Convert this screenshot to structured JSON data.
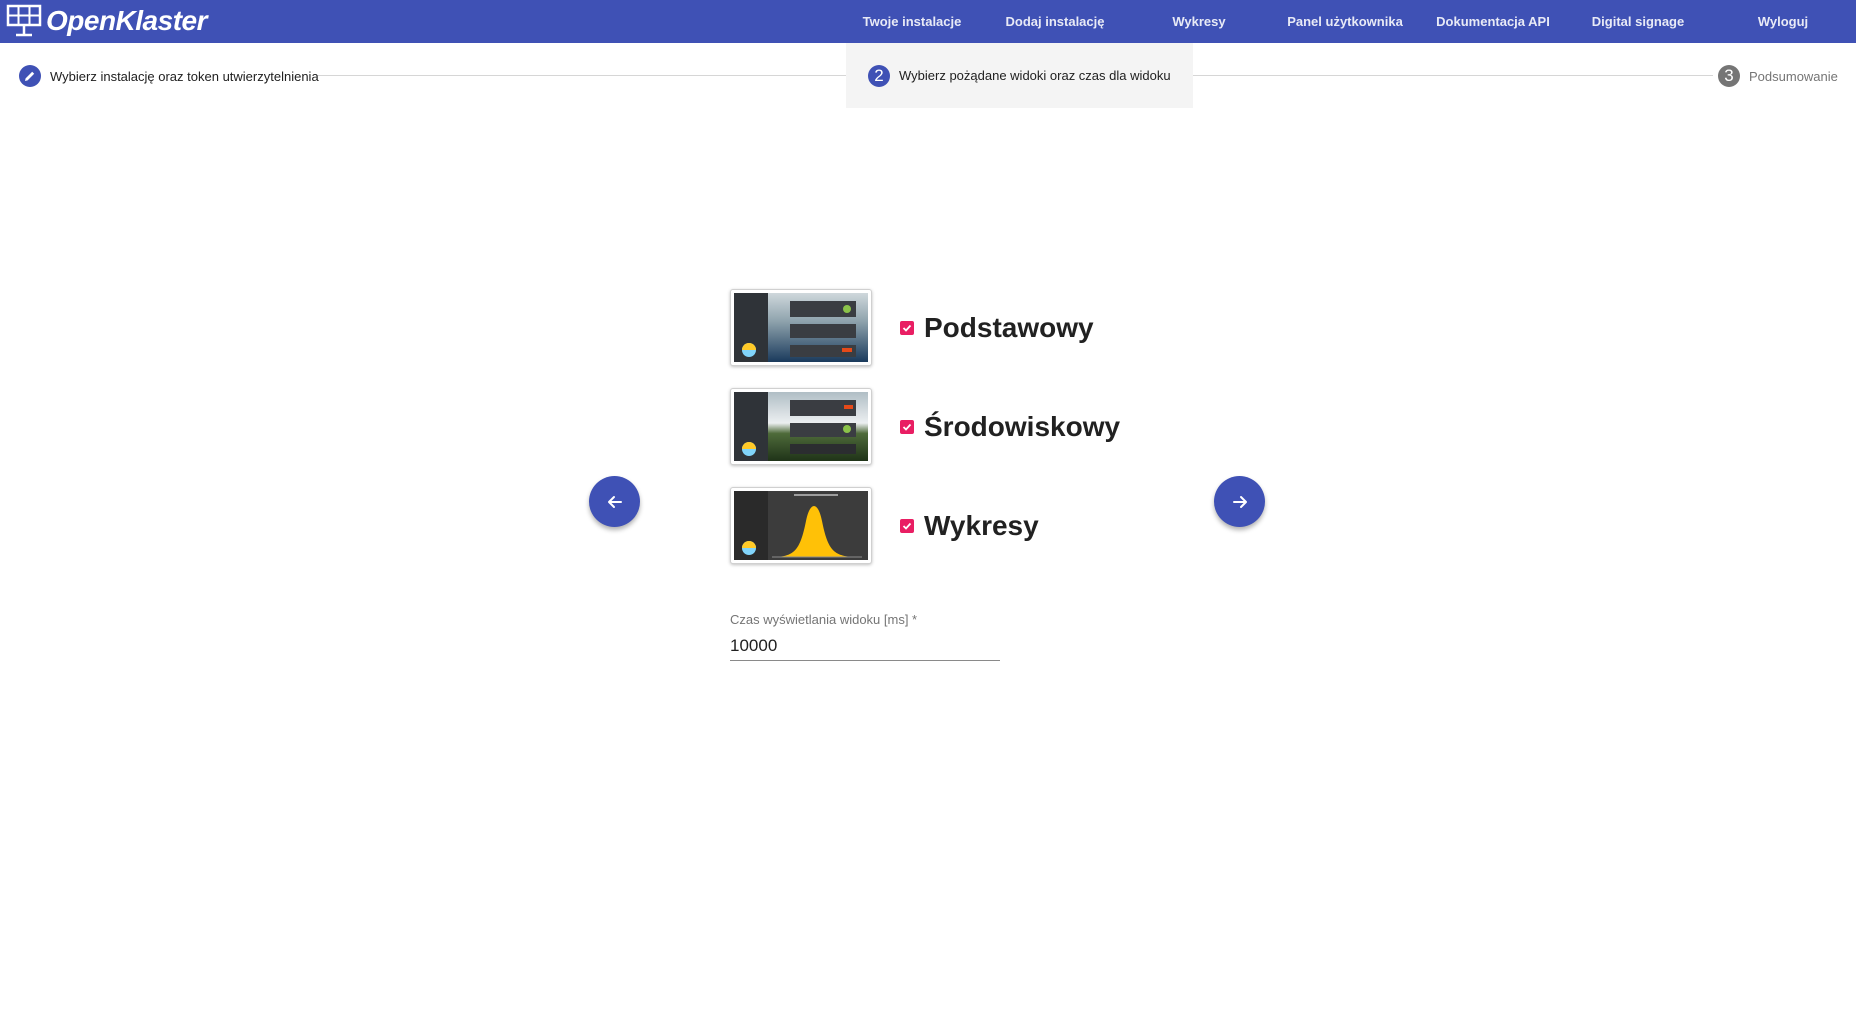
{
  "app": {
    "brand": "OpenKlaster",
    "colors": {
      "primary": "#3f51b5",
      "accent": "#e91e63",
      "chart_fill": "#ffc107"
    }
  },
  "nav": {
    "items": [
      {
        "label": "Twoje instalacje"
      },
      {
        "label": "Dodaj instalację"
      },
      {
        "label": "Wykresy"
      },
      {
        "label": "Panel użytkownika"
      },
      {
        "label": "Dokumentacja API"
      },
      {
        "label": "Digital signage"
      },
      {
        "label": "Wyloguj"
      }
    ]
  },
  "stepper": {
    "steps": [
      {
        "index": "1",
        "label": "Wybierz instalację oraz token utwierzytelnienia",
        "state": "done",
        "icon": "pencil-icon"
      },
      {
        "index": "2",
        "label": "Wybierz pożądane widoki oraz czas dla widoku",
        "state": "active"
      },
      {
        "index": "3",
        "label": "Podsumowanie",
        "state": "todo"
      }
    ]
  },
  "views": [
    {
      "label": "Podstawowy",
      "checked": true,
      "thumbnail": "basic-view-thumbnail"
    },
    {
      "label": "Środowiskowy",
      "checked": true,
      "thumbnail": "environmental-view-thumbnail"
    },
    {
      "label": "Wykresy",
      "checked": true,
      "thumbnail": "charts-view-thumbnail"
    }
  ],
  "navigation": {
    "back_icon": "arrow-left-icon",
    "next_icon": "arrow-right-icon"
  },
  "display_time": {
    "label": "Czas wyświetlania widoku [ms] *",
    "value": "10000"
  }
}
